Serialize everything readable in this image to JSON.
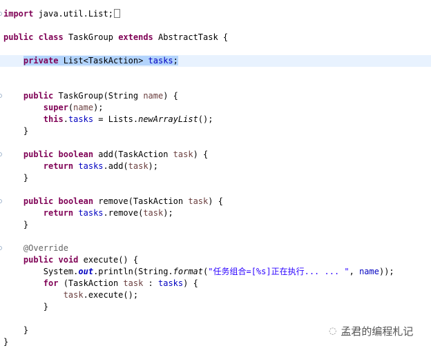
{
  "editor": {
    "current_line": 4,
    "fold_markers": [
      0,
      7,
      12,
      16,
      20
    ],
    "lines": [
      [
        [
          "import",
          "kw"
        ],
        [
          " java.util.List;",
          ""
        ],
        [
          "",
          "collapsed"
        ]
      ],
      [],
      [
        [
          "public",
          "kw"
        ],
        [
          " ",
          ""
        ],
        [
          "class",
          "kw"
        ],
        [
          " TaskGroup ",
          ""
        ],
        [
          "extends",
          "kw"
        ],
        [
          " AbstractTask {",
          ""
        ]
      ],
      [],
      [
        [
          "    ",
          ""
        ],
        [
          "private",
          "kw sel"
        ],
        [
          " List<TaskAction> ",
          "sel"
        ],
        [
          "tasks",
          "field sel"
        ],
        [
          ";",
          "sel"
        ]
      ],
      [],
      [],
      [
        [
          "    ",
          ""
        ],
        [
          "public",
          "kw"
        ],
        [
          " TaskGroup(String ",
          ""
        ],
        [
          "name",
          "param"
        ],
        [
          ") {",
          ""
        ]
      ],
      [
        [
          "        ",
          ""
        ],
        [
          "super",
          "kw"
        ],
        [
          "(",
          ""
        ],
        [
          "name",
          "param"
        ],
        [
          ");",
          ""
        ]
      ],
      [
        [
          "        ",
          ""
        ],
        [
          "this",
          "kw"
        ],
        [
          ".",
          ""
        ],
        [
          "tasks",
          "field"
        ],
        [
          " = Lists.",
          ""
        ],
        [
          "newArrayList",
          "smethod"
        ],
        [
          "();",
          ""
        ]
      ],
      [
        [
          "    }",
          ""
        ]
      ],
      [],
      [
        [
          "    ",
          ""
        ],
        [
          "public",
          "kw"
        ],
        [
          " ",
          ""
        ],
        [
          "boolean",
          "kw"
        ],
        [
          " add(TaskAction ",
          ""
        ],
        [
          "task",
          "param"
        ],
        [
          ") {",
          ""
        ]
      ],
      [
        [
          "        ",
          ""
        ],
        [
          "return",
          "kw"
        ],
        [
          " ",
          ""
        ],
        [
          "tasks",
          "field"
        ],
        [
          ".add(",
          ""
        ],
        [
          "task",
          "param"
        ],
        [
          ");",
          ""
        ]
      ],
      [
        [
          "    }",
          ""
        ]
      ],
      [],
      [
        [
          "    ",
          ""
        ],
        [
          "public",
          "kw"
        ],
        [
          " ",
          ""
        ],
        [
          "boolean",
          "kw"
        ],
        [
          " remove(TaskAction ",
          ""
        ],
        [
          "task",
          "param"
        ],
        [
          ") {",
          ""
        ]
      ],
      [
        [
          "        ",
          ""
        ],
        [
          "return",
          "kw"
        ],
        [
          " ",
          ""
        ],
        [
          "tasks",
          "field"
        ],
        [
          ".remove(",
          ""
        ],
        [
          "task",
          "param"
        ],
        [
          ");",
          ""
        ]
      ],
      [
        [
          "    }",
          ""
        ]
      ],
      [],
      [
        [
          "    ",
          ""
        ],
        [
          "@Override",
          "ann"
        ]
      ],
      [
        [
          "    ",
          ""
        ],
        [
          "public",
          "kw"
        ],
        [
          " ",
          ""
        ],
        [
          "void",
          "kw"
        ],
        [
          " execute() {",
          ""
        ]
      ],
      [
        [
          "        System.",
          ""
        ],
        [
          "out",
          "sfield"
        ],
        [
          ".println(String.",
          ""
        ],
        [
          "format",
          "smethod"
        ],
        [
          "(",
          ""
        ],
        [
          "\"任务组合=[%s]正在执行... ... \"",
          "str"
        ],
        [
          ", ",
          ""
        ],
        [
          "name",
          "field"
        ],
        [
          "));",
          ""
        ]
      ],
      [
        [
          "        ",
          ""
        ],
        [
          "for",
          "kw"
        ],
        [
          " (TaskAction ",
          ""
        ],
        [
          "task",
          "param"
        ],
        [
          " : ",
          ""
        ],
        [
          "tasks",
          "field"
        ],
        [
          ") {",
          ""
        ]
      ],
      [
        [
          "            ",
          ""
        ],
        [
          "task",
          "param"
        ],
        [
          ".execute();",
          ""
        ]
      ],
      [
        [
          "        }",
          ""
        ]
      ],
      [],
      [
        [
          "    }",
          ""
        ]
      ],
      [
        [
          "}",
          ""
        ]
      ]
    ]
  },
  "watermark": {
    "icon": "wechat-icon",
    "text": "孟君的编程札记"
  }
}
